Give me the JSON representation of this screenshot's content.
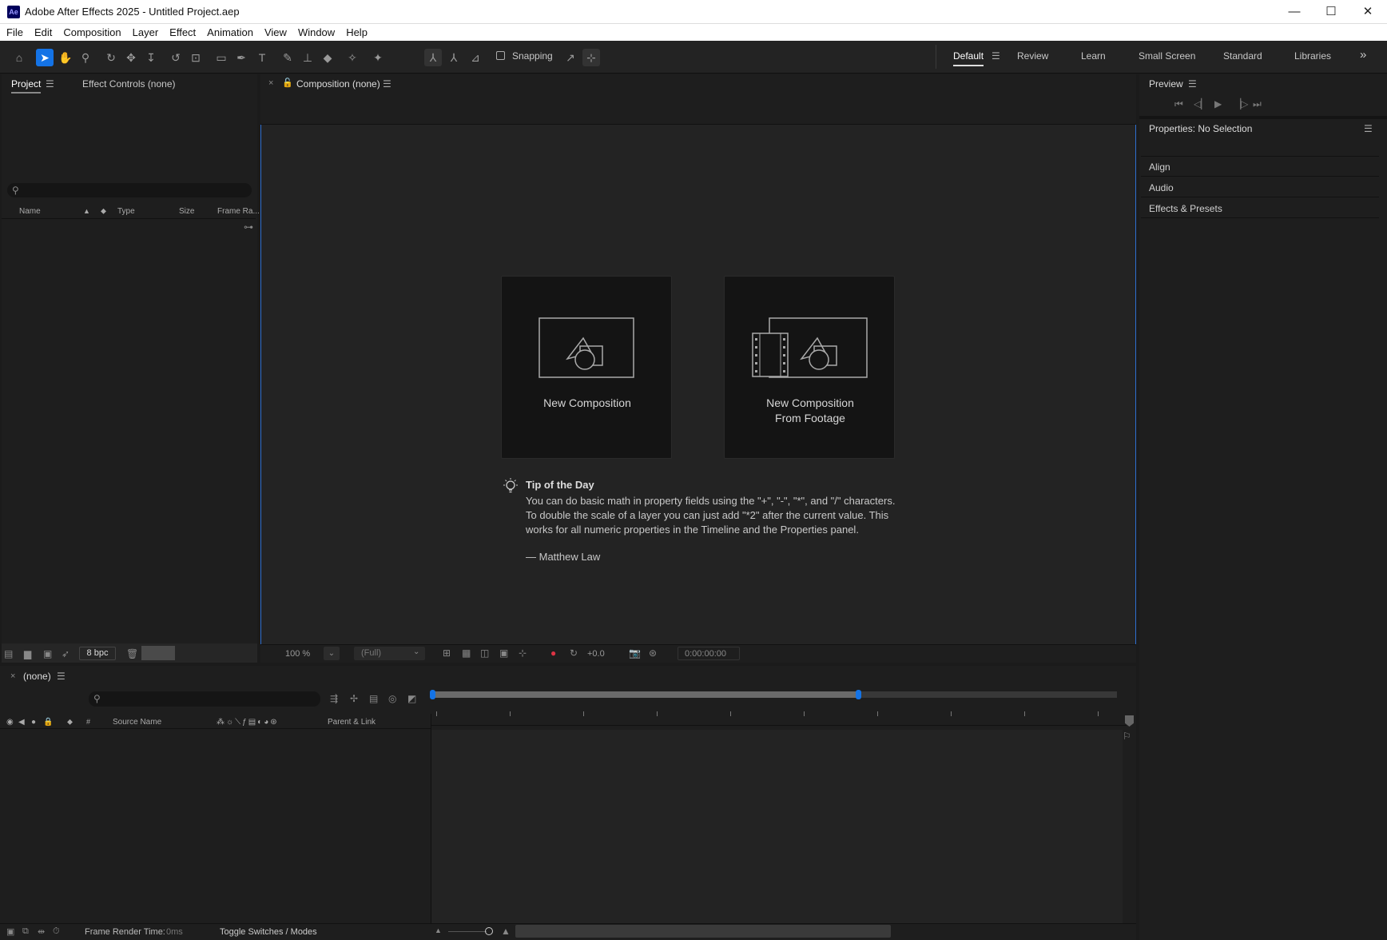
{
  "titlebar": {
    "app_icon_text": "Ae",
    "title": "Adobe After Effects 2025 - Untitled Project.aep",
    "minimize": "—",
    "maximize": "☐",
    "close": "✕"
  },
  "menubar": [
    "File",
    "Edit",
    "Composition",
    "Layer",
    "Effect",
    "Animation",
    "View",
    "Window",
    "Help"
  ],
  "toolbar": {
    "snapping_label": "Snapping",
    "workspaces": [
      "Default",
      "Review",
      "Learn",
      "Small Screen",
      "Standard",
      "Libraries"
    ],
    "more": "»"
  },
  "project_panel": {
    "tabs": [
      "Project",
      "Effect Controls (none)"
    ],
    "columns": [
      "Name",
      "Type",
      "Size",
      "Frame Ra..."
    ],
    "bpc": "8 bpc"
  },
  "composition_panel": {
    "tab_label": "Composition (none)",
    "cards": [
      {
        "label_line1": "New Composition",
        "label_line2": ""
      },
      {
        "label_line1": "New Composition",
        "label_line2": "From Footage"
      }
    ],
    "tip": {
      "title": "Tip of the Day",
      "body": "You can do basic math in property fields using the  \"+\", \"-\", \"*\", and \"/\" characters. To double the scale of a layer you can just add \"*2\" after the current value. This works for all numeric properties in the Timeline and the Properties panel.",
      "author": "— Matthew Law"
    },
    "footer": {
      "zoom": "100 %",
      "resolution": "(Full)",
      "exposure": "+0.0",
      "timecode": "0:00:00:00"
    }
  },
  "right_panel": {
    "preview_title": "Preview",
    "properties_title": "Properties: No Selection",
    "sections": [
      "Align",
      "Audio",
      "Effects & Presets"
    ]
  },
  "timeline": {
    "tab_label": "(none)",
    "source_name_col": "Source Name",
    "parent_col": "Parent & Link",
    "hash_col": "#",
    "frame_render_label": "Frame Render Time:",
    "frame_render_value": "0ms",
    "toggle_label": "Toggle Switches / Modes"
  }
}
